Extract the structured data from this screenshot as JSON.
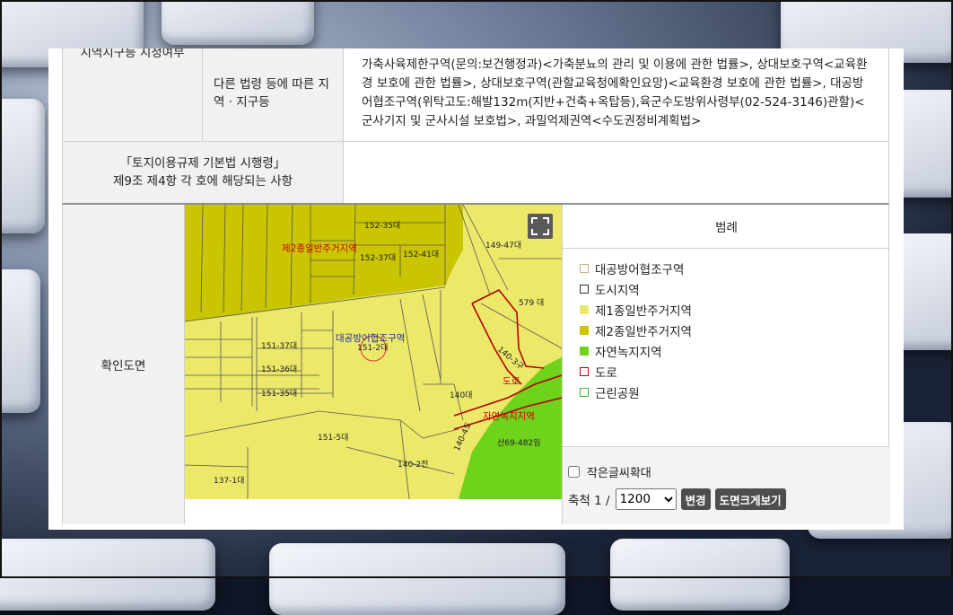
{
  "section_header": {
    "label": "지역지구등 지정여부"
  },
  "other_laws": {
    "label": "다른 법령 등에 따른 지역 · 지구등",
    "content": "가축사육제한구역(문의:보건행정과)<가축분뇨의 관리 및 이용에 관한 법률>, 상대보호구역<교육환경 보호에 관한 법률>, 상대보호구역(관할교육청에확인요망)<교육환경 보호에 관한 법률>, 대공방어협조구역(위탁고도:해발132m(지반+건축+옥탑등),육군수도방위사령부(02-524-3146)관할)<군사기지 및 군사시설 보호법>, 과밀억제권역<수도권정비계획법>"
  },
  "enforcement": {
    "line1": "「토지이용규제 기본법 시행령」",
    "line2": "제9조 제4항 각 호에 해당되는 사항",
    "value": ""
  },
  "map_section": {
    "label": "확인도면",
    "map_labels": {
      "zone2": "제2종일반주거지역",
      "aircraft": "대공방어협조구역",
      "road": "도로",
      "green": "자연녹지지역",
      "parcels": [
        "152-35대",
        "149-47대",
        "579 대",
        "152-41대",
        "152-37대",
        "151-2대",
        "151-37대",
        "151-36대",
        "151-35대",
        "140-3구",
        "140대",
        "151-5대",
        "140-2전",
        "137-1대",
        "산69-482임",
        "140-4도"
      ]
    }
  },
  "legend": {
    "title": "범례",
    "items": [
      {
        "label": "대공방어협조구역",
        "fill": "#ffffff",
        "border": "#c7b27a"
      },
      {
        "label": "도시지역",
        "fill": "#ffffff",
        "border": "#333333"
      },
      {
        "label": "제1종일반주거지역",
        "fill": "#ece96a",
        "border": "#ece96a"
      },
      {
        "label": "제2종일반주거지역",
        "fill": "#c9c500",
        "border": "#c9c500"
      },
      {
        "label": "자연녹지지역",
        "fill": "#6fd21b",
        "border": "#6fd21b"
      },
      {
        "label": "도로",
        "fill": "#ffffff",
        "border": "#c00000"
      },
      {
        "label": "근린공원",
        "fill": "#ffffff",
        "border": "#39b54a"
      }
    ]
  },
  "controls": {
    "small_text_label": "작은글씨확대",
    "scale_label": "축척 1 /",
    "scale_value": "1200",
    "change_button": "변경",
    "enlarge_button": "도면크게보기"
  }
}
